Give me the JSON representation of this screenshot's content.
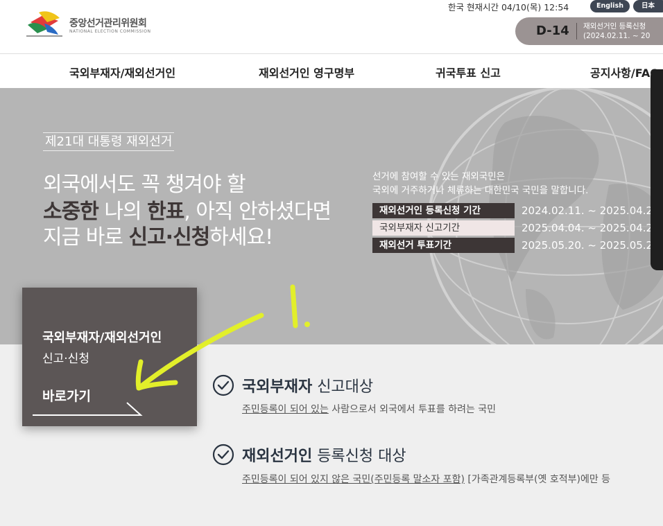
{
  "header": {
    "org_name_ko": "중앙선거관리위원회",
    "org_name_en": "NATIONAL ELECTION COMMISSION",
    "clock": "한국 현재시간 04/10(목) 12:54",
    "lang_english": "English",
    "lang_japanese": "日本",
    "dday": {
      "count": "D-14",
      "line1": "재외선거인 등록신청",
      "line2": "(2024.02.11. ~ 20"
    }
  },
  "nav": {
    "items": [
      "국외부재자/재외선거인",
      "재외선거인 영구명부",
      "귀국투표 신고",
      "공지사항/FAQ"
    ]
  },
  "hero": {
    "tag": "제21대 대통령 재외선거",
    "headline_line1": "외국에서도 꼭 챙겨야 할",
    "headline_line2_bold1": "소중한",
    "headline_line2_mid": " 나의 ",
    "headline_line2_bold2": "한표",
    "headline_line2_end": ", 아직 안하셨다면",
    "headline_line3_start": "지금 바로 ",
    "headline_line3_bold": "신고·신청",
    "headline_line3_end": "하세요!",
    "desc_line1": "선거에 참여할 수 있는 재외국민은",
    "desc_line2": "국외에 거주하거나 체류하는 대한민국 국민을 말합니다.",
    "periods": [
      {
        "label": "재외선거인 등록신청 기간",
        "dates": "2024.02.11. ~ 2025.04.2",
        "highlight": false
      },
      {
        "label": "국외부재자 신고기간",
        "dates": "2025.04.04. ~ 2025.04.2",
        "highlight": true
      },
      {
        "label": "재외선거 투표기간",
        "dates": "2025.05.20. ~ 2025.05.2",
        "highlight": false
      }
    ]
  },
  "card": {
    "line1": "국외부재자/재외선거인",
    "line2": "신고·신청",
    "go": "바로가기"
  },
  "annotation": {
    "text": "1."
  },
  "items": [
    {
      "title_bold": "국외부재자",
      "title_rest": " 신고대상",
      "desc_underlined": "주민등록이 되어 있는",
      "desc_rest": " 사람으로서 외국에서 투표를 하려는 국민"
    },
    {
      "title_bold": "재외선거인",
      "title_rest": " 등록신청 대상",
      "desc_underlined": "주민등록이 되어 있지 않은 국민(주민등록 말소자 포함)",
      "desc_rest": " [가족관계등록부(옛 호적부)에만 등"
    }
  ],
  "colors": {
    "accent_dark": "#3d3636",
    "card_bg": "#5c5656",
    "hero_bg": "#b5b5b5",
    "annotation": "#e2ef2a",
    "navy": "#2a3441"
  }
}
